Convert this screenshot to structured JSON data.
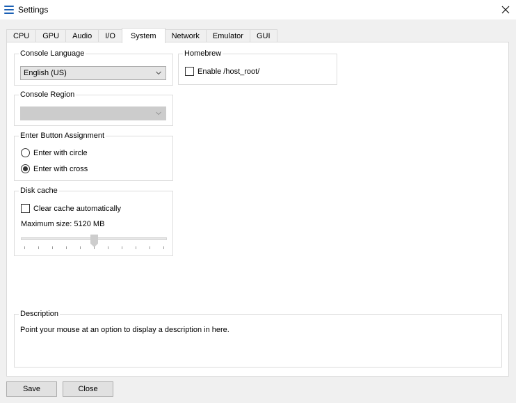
{
  "window": {
    "title": "Settings",
    "logo_icon": "app-logo-icon",
    "close_icon": "close-icon"
  },
  "tabs": [
    {
      "label": "CPU",
      "active": false
    },
    {
      "label": "GPU",
      "active": false
    },
    {
      "label": "Audio",
      "active": false
    },
    {
      "label": "I/O",
      "active": false
    },
    {
      "label": "System",
      "active": true
    },
    {
      "label": "Network",
      "active": false
    },
    {
      "label": "Emulator",
      "active": false
    },
    {
      "label": "GUI",
      "active": false
    }
  ],
  "system": {
    "console_language": {
      "title": "Console Language",
      "selected": "English (US)"
    },
    "console_region": {
      "title": "Console Region",
      "selected": "",
      "disabled": true
    },
    "enter_button": {
      "title": "Enter Button Assignment",
      "options": [
        {
          "label": "Enter with circle",
          "checked": false
        },
        {
          "label": "Enter with cross",
          "checked": true
        }
      ]
    },
    "disk_cache": {
      "title": "Disk cache",
      "clear_auto_label": "Clear cache automatically",
      "clear_auto_checked": false,
      "max_size_label": "Maximum size: 5120 MB",
      "slider": {
        "ticks": 11,
        "value_index": 5
      }
    },
    "homebrew": {
      "title": "Homebrew",
      "enable_host_root_label": "Enable /host_root/",
      "enable_host_root_checked": false
    }
  },
  "description": {
    "title": "Description",
    "text": "Point your mouse at an option to display a description in here."
  },
  "footer": {
    "save_label": "Save",
    "close_label": "Close"
  }
}
